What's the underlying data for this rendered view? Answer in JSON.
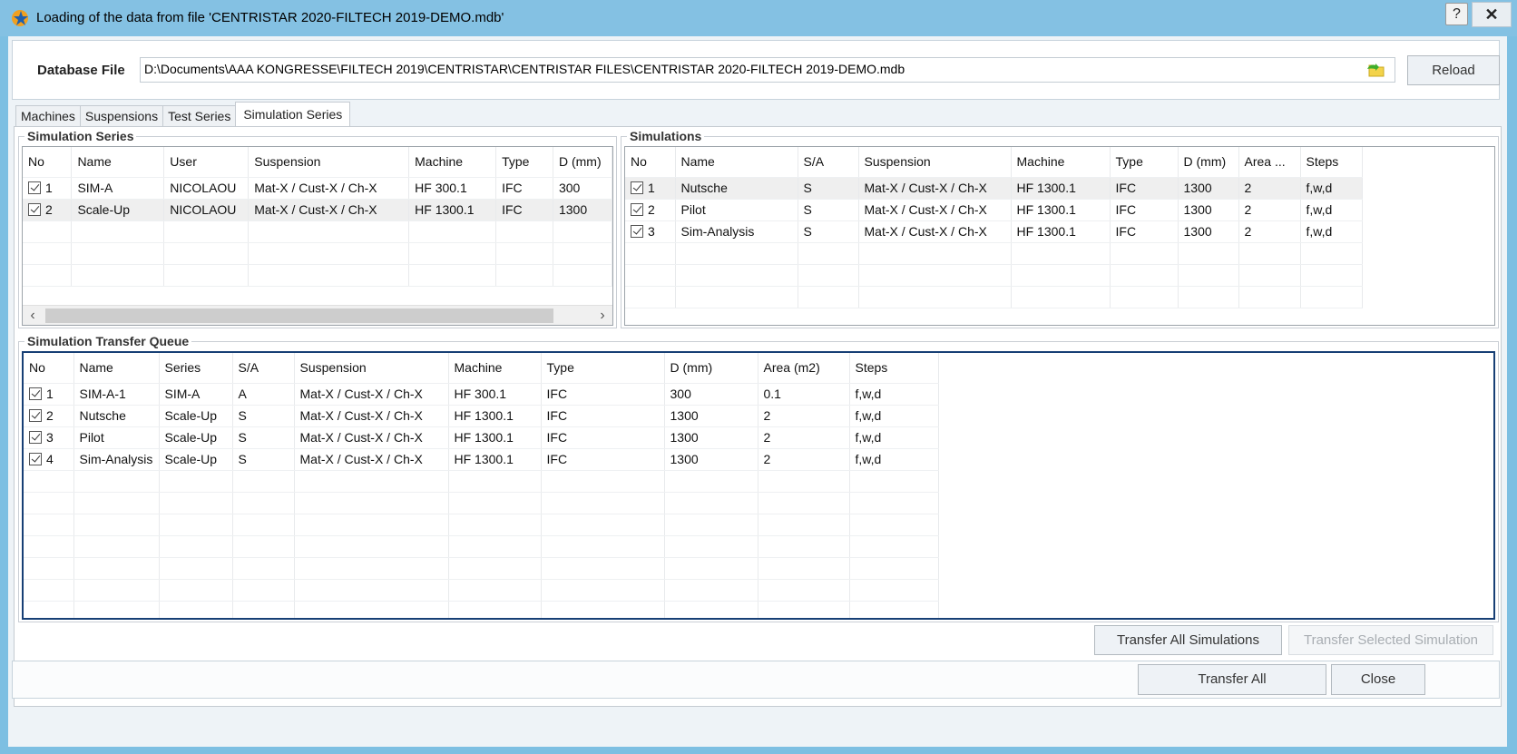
{
  "window": {
    "title": "Loading of the data from file 'CENTRISTAR 2020-FILTECH 2019-DEMO.mdb'",
    "icon": "app-star-icon",
    "help_label": "?",
    "close_label": "✕"
  },
  "database": {
    "label": "Database File",
    "path": "D:\\Documents\\AAA KONGRESSE\\FILTECH 2019\\CENTRISTAR\\CENTRISTAR FILES\\CENTRISTAR 2020-FILTECH 2019-DEMO.mdb",
    "browse_icon": "folder-open-icon",
    "reload_label": "Reload"
  },
  "tabs": [
    {
      "label": "Machines",
      "active": false
    },
    {
      "label": "Suspensions",
      "active": false
    },
    {
      "label": "Test Series",
      "active": false
    },
    {
      "label": "Simulation Series",
      "active": true
    }
  ],
  "simulation_series": {
    "title": "Simulation Series",
    "columns": [
      "No",
      "Name",
      "User",
      "Suspension",
      "Machine",
      "Type",
      "D (mm)"
    ],
    "rows": [
      {
        "checked": true,
        "no": "1",
        "name": "SIM-A",
        "user": "NICOLAOU",
        "suspension": "Mat-X / Cust-X / Ch-X",
        "machine": "HF 300.1",
        "type": "IFC",
        "d": "300"
      },
      {
        "checked": true,
        "no": "2",
        "name": "Scale-Up",
        "user": "NICOLAOU",
        "suspension": "Mat-X / Cust-X / Ch-X",
        "machine": "HF 1300.1",
        "type": "IFC",
        "d": "1300"
      }
    ],
    "selected_row": 2,
    "scroll_left": "‹",
    "scroll_right": "›"
  },
  "simulations": {
    "title": "Simulations",
    "columns": [
      "No",
      "Name",
      "S/A",
      "Suspension",
      "Machine",
      "Type",
      "D (mm)",
      "Area ...",
      "Steps"
    ],
    "rows": [
      {
        "checked": true,
        "no": "1",
        "name": "Nutsche",
        "sa": "S",
        "suspension": "Mat-X / Cust-X / Ch-X",
        "machine": "HF 1300.1",
        "type": "IFC",
        "d": "1300",
        "area": "2",
        "steps": "f,w,d"
      },
      {
        "checked": true,
        "no": "2",
        "name": "Pilot",
        "sa": "S",
        "suspension": "Mat-X / Cust-X / Ch-X",
        "machine": "HF 1300.1",
        "type": "IFC",
        "d": "1300",
        "area": "2",
        "steps": "f,w,d"
      },
      {
        "checked": true,
        "no": "3",
        "name": "Sim-Analysis",
        "sa": "S",
        "suspension": "Mat-X / Cust-X / Ch-X",
        "machine": "HF 1300.1",
        "type": "IFC",
        "d": "1300",
        "area": "2",
        "steps": "f,w,d"
      }
    ],
    "selected_row": 1
  },
  "queue": {
    "title": "Simulation Transfer Queue",
    "columns": [
      "No",
      "Name",
      "Series",
      "S/A",
      "Suspension",
      "Machine",
      "Type",
      "D (mm)",
      "Area (m2)",
      "Steps"
    ],
    "rows": [
      {
        "checked": true,
        "no": "1",
        "name": "SIM-A-1",
        "series": "SIM-A",
        "sa": "A",
        "suspension": "Mat-X / Cust-X / Ch-X",
        "machine": "HF 300.1",
        "type": "IFC",
        "d": "300",
        "area": "0.1",
        "steps": "f,w,d"
      },
      {
        "checked": true,
        "no": "2",
        "name": "Nutsche",
        "series": "Scale-Up",
        "sa": "S",
        "suspension": "Mat-X / Cust-X / Ch-X",
        "machine": "HF 1300.1",
        "type": "IFC",
        "d": "1300",
        "area": "2",
        "steps": "f,w,d"
      },
      {
        "checked": true,
        "no": "3",
        "name": "Pilot",
        "series": "Scale-Up",
        "sa": "S",
        "suspension": "Mat-X / Cust-X / Ch-X",
        "machine": "HF 1300.1",
        "type": "IFC",
        "d": "1300",
        "area": "2",
        "steps": "f,w,d"
      },
      {
        "checked": true,
        "no": "4",
        "name": "Sim-Analysis",
        "series": "Scale-Up",
        "sa": "S",
        "suspension": "Mat-X / Cust-X / Ch-X",
        "machine": "HF 1300.1",
        "type": "IFC",
        "d": "1300",
        "area": "2",
        "steps": "f,w,d"
      }
    ]
  },
  "buttons": {
    "transfer_all_simulations": "Transfer All Simulations",
    "transfer_selected_simulation": "Transfer Selected Simulation",
    "transfer_all": "Transfer All",
    "close": "Close"
  }
}
